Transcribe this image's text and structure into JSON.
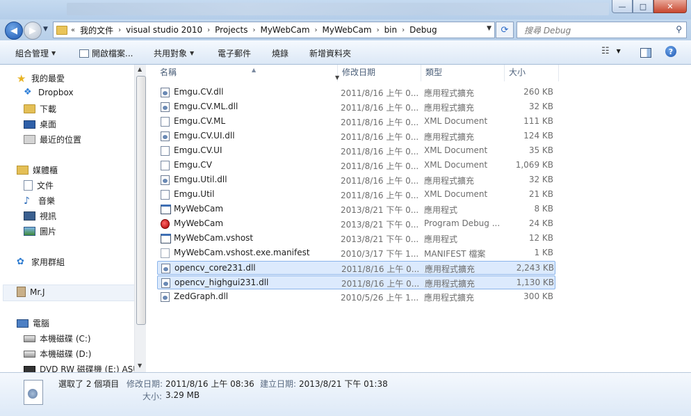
{
  "window": {
    "minimize_glyph": "—",
    "maximize_glyph": "□",
    "close_glyph": "✕"
  },
  "address": {
    "overflow": "«",
    "crumbs": [
      "我的文件",
      "visual studio 2010",
      "Projects",
      "MyWebCam",
      "MyWebCam",
      "bin",
      "Debug"
    ],
    "search_placeholder": "搜尋 Debug"
  },
  "toolbar": {
    "organize": "組合管理",
    "open_file": "開啟檔案...",
    "share": "共用對象",
    "email": "電子郵件",
    "burn": "燒錄",
    "new_folder": "新增資料夾"
  },
  "nav": {
    "favorites": "我的最愛",
    "dropbox": "Dropbox",
    "downloads": "下載",
    "desktop": "桌面",
    "recent": "最近的位置",
    "libraries": "媒體櫃",
    "documents": "文件",
    "music": "音樂",
    "videos": "視訊",
    "pictures": "圖片",
    "homegroup": "家用群組",
    "user": "Mr.J",
    "computer": "電腦",
    "drive_c": "本機磁碟 (C:)",
    "drive_d": "本機磁碟 (D:)",
    "drive_e": "DVD RW 磁碟機 (E:) ASU"
  },
  "columns": {
    "name": "名稱",
    "date": "修改日期",
    "type": "類型",
    "size": "大小"
  },
  "files": [
    {
      "name": "Emgu.CV.dll",
      "date": "2011/8/16 上午 0...",
      "type": "應用程式擴充",
      "size": "260 KB",
      "icon": "dll"
    },
    {
      "name": "Emgu.CV.ML.dll",
      "date": "2011/8/16 上午 0...",
      "type": "應用程式擴充",
      "size": "32 KB",
      "icon": "dll"
    },
    {
      "name": "Emgu.CV.ML",
      "date": "2011/8/16 上午 0...",
      "type": "XML Document",
      "size": "111 KB",
      "icon": "xml"
    },
    {
      "name": "Emgu.CV.UI.dll",
      "date": "2011/8/16 上午 0...",
      "type": "應用程式擴充",
      "size": "124 KB",
      "icon": "dll"
    },
    {
      "name": "Emgu.CV.UI",
      "date": "2011/8/16 上午 0...",
      "type": "XML Document",
      "size": "35 KB",
      "icon": "xml"
    },
    {
      "name": "Emgu.CV",
      "date": "2011/8/16 上午 0...",
      "type": "XML Document",
      "size": "1,069 KB",
      "icon": "xml"
    },
    {
      "name": "Emgu.Util.dll",
      "date": "2011/8/16 上午 0...",
      "type": "應用程式擴充",
      "size": "32 KB",
      "icon": "dll"
    },
    {
      "name": "Emgu.Util",
      "date": "2011/8/16 上午 0...",
      "type": "XML Document",
      "size": "21 KB",
      "icon": "xml"
    },
    {
      "name": "MyWebCam",
      "date": "2013/8/21 下午 0...",
      "type": "應用程式",
      "size": "8 KB",
      "icon": "exe"
    },
    {
      "name": "MyWebCam",
      "date": "2013/8/21 下午 0...",
      "type": "Program Debug ...",
      "size": "24 KB",
      "icon": "pdb"
    },
    {
      "name": "MyWebCam.vshost",
      "date": "2013/8/21 下午 0...",
      "type": "應用程式",
      "size": "12 KB",
      "icon": "exe"
    },
    {
      "name": "MyWebCam.vshost.exe.manifest",
      "date": "2010/3/17 下午 1...",
      "type": "MANIFEST 檔案",
      "size": "1 KB",
      "icon": "manifest"
    },
    {
      "name": "opencv_core231.dll",
      "date": "2011/8/16 上午 0...",
      "type": "應用程式擴充",
      "size": "2,243 KB",
      "icon": "dll",
      "selected": true
    },
    {
      "name": "opencv_highgui231.dll",
      "date": "2011/8/16 上午 0...",
      "type": "應用程式擴充",
      "size": "1,130 KB",
      "icon": "dll",
      "selected": true
    },
    {
      "name": "ZedGraph.dll",
      "date": "2010/5/26 上午 1...",
      "type": "應用程式擴充",
      "size": "300 KB",
      "icon": "dll"
    }
  ],
  "details": {
    "selection": "選取了 2 個項目",
    "modified_label": "修改日期:",
    "modified_value": "2011/8/16 上午 08:36",
    "created_label": "建立日期:",
    "created_value": "2013/8/21 下午 01:38",
    "size_label": "大小:",
    "size_value": "3.29 MB"
  }
}
